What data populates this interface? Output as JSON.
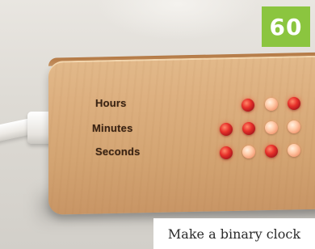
{
  "badge": {
    "number": "60",
    "color": "#8bc53f"
  },
  "caption": "Make a binary clock",
  "clock": {
    "rows": [
      {
        "label": "Hours",
        "leds": [
          "on",
          "off",
          "on"
        ]
      },
      {
        "label": "Minutes",
        "leds": [
          "on",
          "on",
          "off",
          "off"
        ]
      },
      {
        "label": "Seconds",
        "leds": [
          "on",
          "off",
          "on",
          "off"
        ]
      }
    ]
  }
}
